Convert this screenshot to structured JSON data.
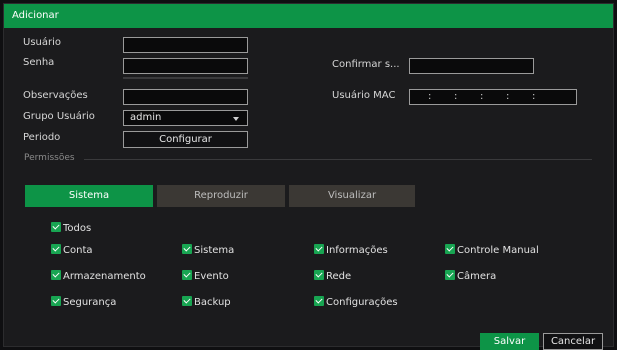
{
  "dialog": {
    "title": "Adicionar"
  },
  "form": {
    "user_label": "Usuário",
    "password_label": "Senha",
    "confirm_label": "Confirmar s...",
    "notes_label": "Observações",
    "mac_label": "Usuário MAC",
    "group_label": "Grupo Usuário",
    "group_value": "admin",
    "period_label": "Periodo",
    "configure_button": "Configurar",
    "user_value": "",
    "password_value": "",
    "confirm_value": "",
    "notes_value": ""
  },
  "permissions": {
    "section_label": "Permissões",
    "tabs": [
      {
        "label": "Sistema",
        "active": true
      },
      {
        "label": "Reproduzir",
        "active": false
      },
      {
        "label": "Visualizar",
        "active": false
      }
    ],
    "all_label": "Todos",
    "items": [
      "Conta",
      "Sistema",
      "Informações",
      "Controle Manual",
      "Armazenamento",
      "Evento",
      "Rede",
      "Câmera",
      "Segurança",
      "Backup",
      "Configurações"
    ]
  },
  "footer": {
    "save_label": "Salvar",
    "cancel_label": "Cancelar"
  },
  "colors": {
    "accent": "#0d9447",
    "background": "#1b1b1d",
    "tab_inactive": "#3b3834"
  }
}
